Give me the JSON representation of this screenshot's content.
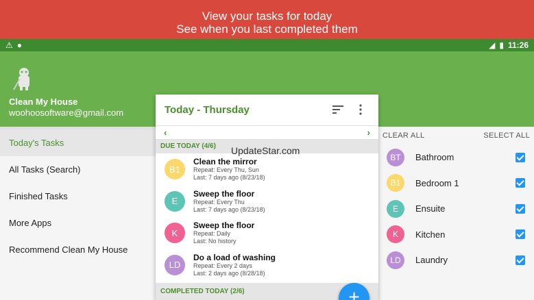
{
  "banner": {
    "line1": "View your tasks for today",
    "line2": "See when you last completed them"
  },
  "status": {
    "time": "11:26",
    "icons": [
      "warning-icon",
      "android-icon",
      "signal-icon",
      "battery-icon"
    ]
  },
  "app": {
    "name": "Clean My House",
    "email": "woohoosoftware@gmail.com"
  },
  "drawer": {
    "items": [
      {
        "label": "Today's Tasks",
        "active": true
      },
      {
        "label": "All Tasks (Search)",
        "active": false
      },
      {
        "label": "Finished Tasks",
        "active": false
      },
      {
        "label": "More Apps",
        "active": false
      },
      {
        "label": "Recommend Clean My House",
        "active": false
      }
    ]
  },
  "card": {
    "title": "Today - Thursday",
    "prev": "‹",
    "next": "›",
    "due_header": "DUE TODAY (4/6)",
    "completed_header": "COMPLETED TODAY (2/6)",
    "watermark": "UpdateStar.com",
    "tasks": [
      {
        "initials": "B1",
        "title": "Clean the mirror",
        "repeat": "Repeat: Every Thu, Sun",
        "last": "Last: 7 days ago (8/23/18)",
        "color": "#fbd86b"
      },
      {
        "initials": "E",
        "title": "Sweep the floor",
        "repeat": "Repeat: Every Thu",
        "last": "Last: 7 days ago (8/23/18)",
        "color": "#5ec4b6"
      },
      {
        "initials": "K",
        "title": "Sweep the floor",
        "repeat": "Repeat: Daily",
        "last": "Last: No history",
        "color": "#f06292"
      },
      {
        "initials": "LD",
        "title": "Do a load of washing",
        "repeat": "Repeat: Every 2 days",
        "last": "Last: 2 days ago (8/28/18)",
        "color": "#ba8fd6"
      }
    ]
  },
  "rooms": {
    "clear_all": "CLEAR ALL",
    "select_all": "SELECT ALL",
    "items": [
      {
        "initials": "BT",
        "name": "Bathroom",
        "color": "#ba8fd6"
      },
      {
        "initials": "B1",
        "name": "Bedroom 1",
        "color": "#fbd86b"
      },
      {
        "initials": "E",
        "name": "Ensuite",
        "color": "#5ec4b6"
      },
      {
        "initials": "K",
        "name": "Kitchen",
        "color": "#f06292"
      },
      {
        "initials": "LD",
        "name": "Laundry",
        "color": "#ba8fd6"
      }
    ]
  },
  "fab": {
    "label": "+"
  },
  "colors": {
    "banner": "#d9483d",
    "appbar": "#6ab04c",
    "accent": "#4a8f2c",
    "fab": "#2196f3"
  }
}
